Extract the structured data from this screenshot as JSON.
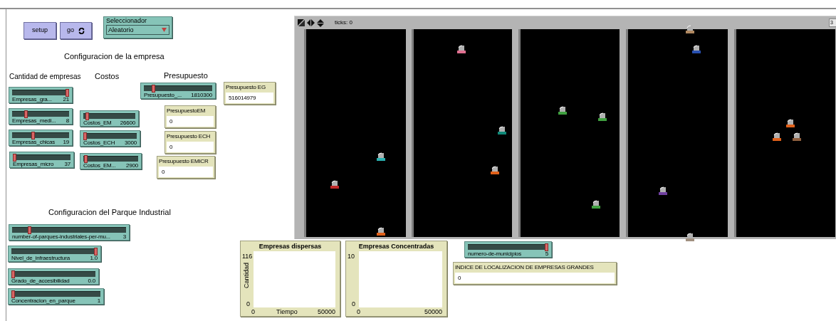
{
  "buttons": [
    {
      "label": "setup",
      "forever": false
    },
    {
      "label": "go",
      "forever": true
    }
  ],
  "chooser": {
    "label": "Seleccionador",
    "value": "Aleatorio"
  },
  "labels": [
    "Configuracion de la empresa",
    "Cantidad de empresas",
    "Costos",
    "Presupuesto",
    "Configuracion del Parque Industrial"
  ],
  "sliders": [
    {
      "label": "Empresas_gra...",
      "value": "21",
      "level": 1
    },
    {
      "label": "Empresas_medi...",
      "value": "8",
      "level": 0.22
    },
    {
      "label": "Empresas_chicas",
      "value": "19",
      "level": 0.36
    },
    {
      "label": "Empresas_micro",
      "value": "37",
      "level": 0
    },
    {
      "label": "Costos_EM",
      "value": "26600",
      "level": 0.04
    },
    {
      "label": "Costos_ECH",
      "value": "3000",
      "level": 0
    },
    {
      "label": "Costos_EM...",
      "value": "2900",
      "level": 0.02
    },
    {
      "label": "Presupuesto_...",
      "value": "1810300",
      "level": 0.12
    },
    {
      "label": "number-of-parques-industriales-per-mu...",
      "value": "3",
      "level": 0.14
    },
    {
      "label": "Nivel_de_infraestructura",
      "value": "1.0",
      "level": 1
    },
    {
      "label": "Grado_de_accesibilidad",
      "value": "0.0",
      "level": 0
    },
    {
      "label": "Concentracion_en_parque",
      "value": "1",
      "level": 0
    },
    {
      "label": "numero-de-municipios",
      "value": "5",
      "level": 1
    }
  ],
  "monitors": [
    {
      "label": "Presupuesto EG",
      "value": "516014979"
    },
    {
      "label": "PresupuestoEM",
      "value": "0"
    },
    {
      "label": "Presupuesto ECH",
      "value": "0"
    },
    {
      "label": "Presupuesto EMICR",
      "value": "0"
    },
    {
      "label": "INDICE DE LOCALIZACION DE EMPRESAS GRANDES",
      "value": "0"
    }
  ],
  "view": {
    "ticks": "ticks: 0",
    "button_3d": "3",
    "panes": [
      {
        "turtles": [
          {
            "color": "#c02828"
          },
          {
            "color": "#2ab0b0"
          },
          {
            "color": "#e0601a"
          }
        ]
      },
      {
        "turtles": [
          {
            "color": "#e07090"
          },
          {
            "color": "#108878"
          },
          {
            "color": "#e0601a"
          }
        ]
      },
      {
        "turtles": [
          {
            "color": "#40a040"
          },
          {
            "color": "#40a040"
          },
          {
            "color": "#40a040"
          }
        ]
      },
      {
        "turtles": [
          {
            "color": "#b08860"
          },
          {
            "color": "#2850b0"
          },
          {
            "color": "#7040a0"
          },
          {
            "color": "#a09080"
          }
        ]
      },
      {
        "turtles": [
          {
            "color": "#e0601a"
          },
          {
            "color": "#e0601a"
          },
          {
            "color": "#906040"
          }
        ]
      }
    ]
  },
  "plots": [
    {
      "title": "Empresas dispersas",
      "ylabel": "Cantidad",
      "xlabel": "Tiempo",
      "y_max": "116",
      "y_min": "0",
      "x_min": "0",
      "x_max": "50000"
    },
    {
      "title": "Empresas Concentradas",
      "y_max": "10",
      "y_min": "0",
      "x_min": "0",
      "x_max": "50000"
    }
  ]
}
